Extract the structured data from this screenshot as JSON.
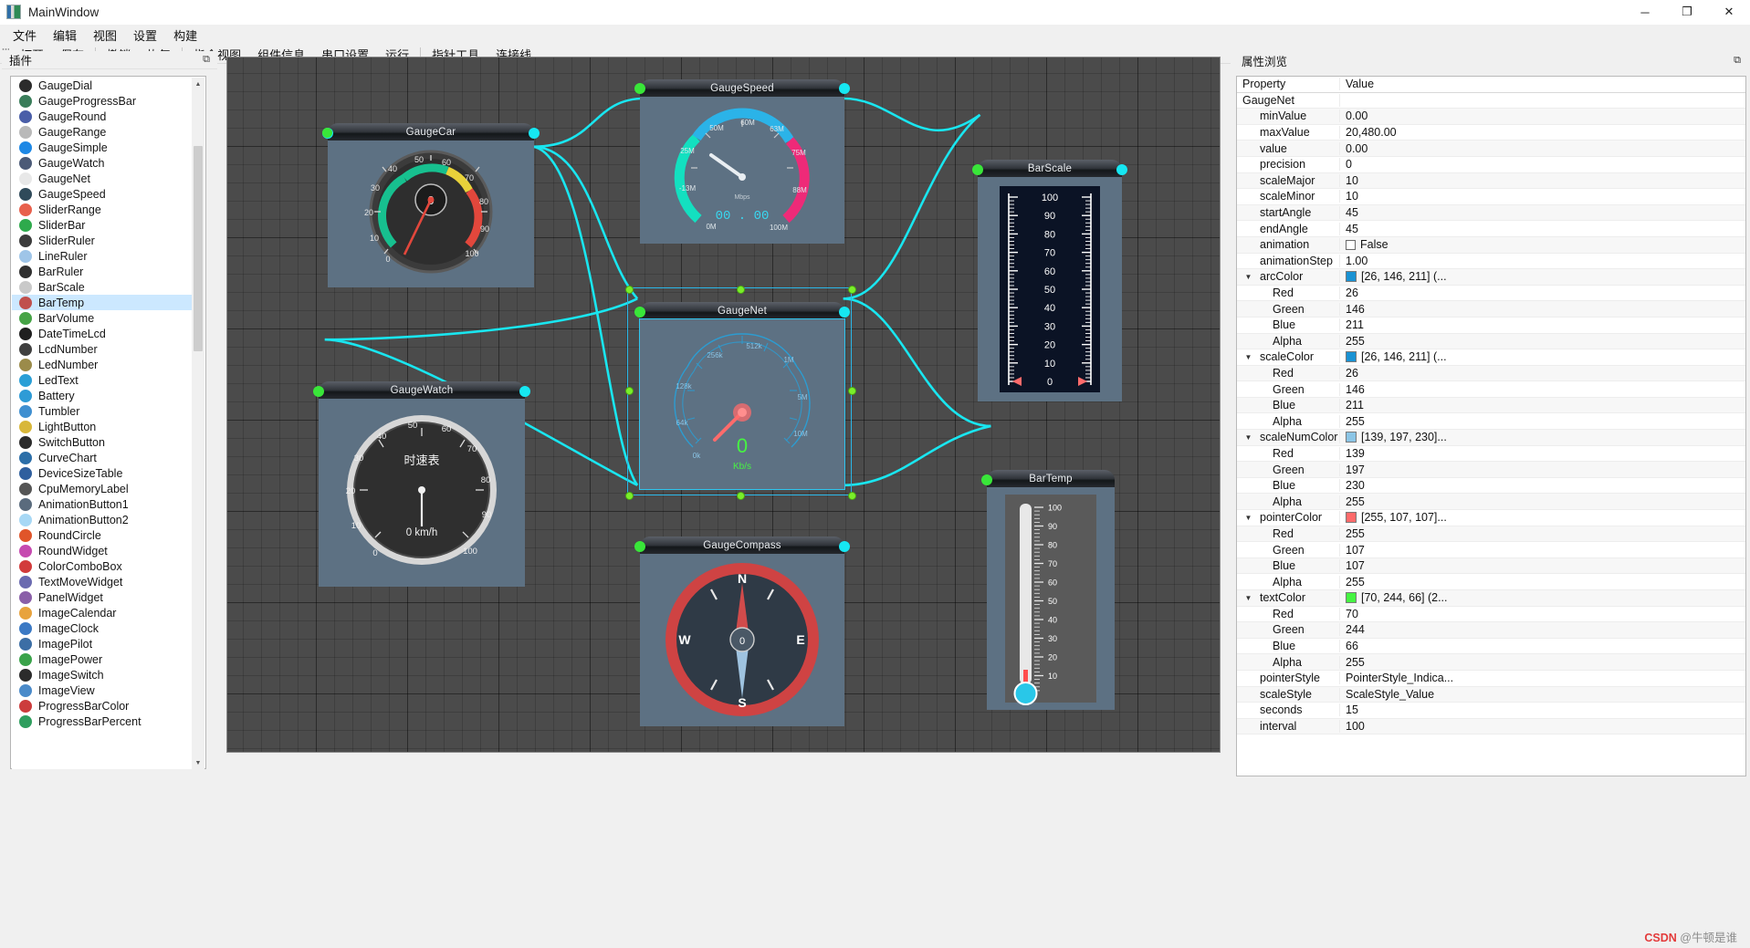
{
  "window": {
    "title": "MainWindow",
    "icon": "app-icon",
    "buttons": {
      "minimize": "─",
      "maximize": "❐",
      "close": "✕"
    }
  },
  "menubar": {
    "items": [
      "文件",
      "编辑",
      "视图",
      "设置",
      "构建"
    ]
  },
  "toolbar": {
    "groups": [
      [
        "打开",
        "保存"
      ],
      [
        "撤销",
        "恢复"
      ],
      [
        "指令视图",
        "组件信息",
        "串口设置",
        "运行"
      ],
      [
        "指针工具",
        "连接线"
      ]
    ]
  },
  "left_dock": {
    "title": "插件",
    "float_icon": "undock-icon",
    "selected": "BarTemp",
    "items": [
      {
        "label": "GaugeDial",
        "color": "#2b2b2b"
      },
      {
        "label": "GaugeProgressBar",
        "color": "#3a7d5a"
      },
      {
        "label": "GaugeRound",
        "color": "#4a5ea8"
      },
      {
        "label": "GaugeRange",
        "color": "#b9b9b9"
      },
      {
        "label": "GaugeSimple",
        "color": "#1e88e5"
      },
      {
        "label": "GaugeWatch",
        "color": "#4b5a77"
      },
      {
        "label": "GaugeNet",
        "color": "#e8e8e8"
      },
      {
        "label": "GaugeSpeed",
        "color": "#2f4a5a"
      },
      {
        "label": "SliderRange",
        "color": "#e8604c"
      },
      {
        "label": "SliderBar",
        "color": "#2eaa4c"
      },
      {
        "label": "SliderRuler",
        "color": "#3b3b3b"
      },
      {
        "label": "LineRuler",
        "color": "#9fc5e8"
      },
      {
        "label": "BarRuler",
        "color": "#303030"
      },
      {
        "label": "BarScale",
        "color": "#c9c9c9"
      },
      {
        "label": "BarTemp",
        "color": "#c0504d"
      },
      {
        "label": "BarVolume",
        "color": "#46a346"
      },
      {
        "label": "DateTimeLcd",
        "color": "#1f1f1f"
      },
      {
        "label": "LcdNumber",
        "color": "#404040"
      },
      {
        "label": "LedNumber",
        "color": "#9b8b4a"
      },
      {
        "label": "LedText",
        "color": "#2a9fd6"
      },
      {
        "label": "Battery",
        "color": "#2e9bd6"
      },
      {
        "label": "Tumbler",
        "color": "#3f8fd0"
      },
      {
        "label": "LightButton",
        "color": "#d8b73a"
      },
      {
        "label": "SwitchButton",
        "color": "#2b2b2b"
      },
      {
        "label": "CurveChart",
        "color": "#2b6ea8"
      },
      {
        "label": "DeviceSizeTable",
        "color": "#2f5f9e"
      },
      {
        "label": "CpuMemoryLabel",
        "color": "#555555"
      },
      {
        "label": "AnimationButton1",
        "color": "#5a6b7d"
      },
      {
        "label": "AnimationButton2",
        "color": "#a7d8f5"
      },
      {
        "label": "RoundCircle",
        "color": "#e0552a"
      },
      {
        "label": "RoundWidget",
        "color": "#c64ab0"
      },
      {
        "label": "ColorComboBox",
        "color": "#d23b3b"
      },
      {
        "label": "TextMoveWidget",
        "color": "#6a6ab0"
      },
      {
        "label": "PanelWidget",
        "color": "#8a5fa8"
      },
      {
        "label": "ImageCalendar",
        "color": "#e8a33d"
      },
      {
        "label": "ImageClock",
        "color": "#3b79c4"
      },
      {
        "label": "ImagePilot",
        "color": "#3c6ea5"
      },
      {
        "label": "ImagePower",
        "color": "#3aa34a"
      },
      {
        "label": "ImageSwitch",
        "color": "#2b2b2b"
      },
      {
        "label": "ImageView",
        "color": "#4a8ac9"
      },
      {
        "label": "ProgressBarColor",
        "color": "#cc3c3c"
      },
      {
        "label": "ProgressBarPercent",
        "color": "#2f9e5e"
      }
    ]
  },
  "canvas": {
    "widgets": [
      {
        "name": "GaugeCar",
        "title": "GaugeCar"
      },
      {
        "name": "GaugeSpeed",
        "title": "GaugeSpeed"
      },
      {
        "name": "GaugeNet",
        "title": "GaugeNet",
        "selected": true
      },
      {
        "name": "GaugeWatch",
        "title": "GaugeWatch"
      },
      {
        "name": "GaugeCompass",
        "title": "GaugeCompass"
      },
      {
        "name": "BarScale",
        "title": "BarScale"
      },
      {
        "name": "BarTemp",
        "title": "BarTemp"
      }
    ],
    "gauge_car": {
      "ticks": [
        "0",
        "10",
        "20",
        "30",
        "40",
        "50",
        "60",
        "70",
        "80",
        "90",
        "100"
      ],
      "value": "0"
    },
    "gauge_speed": {
      "ticks": [
        "0M",
        "25M",
        "50M",
        "60M",
        "63M",
        "75M",
        "88M",
        "100M"
      ],
      "unit": "Mbps",
      "display": "00 . 00"
    },
    "gauge_net": {
      "ticks": [
        "0k",
        "64k",
        "128k",
        "256k",
        "512k",
        "1M",
        "5M",
        "10M"
      ],
      "value": "0",
      "unit": "Kb/s"
    },
    "gauge_watch": {
      "label": "时速表",
      "ticks": [
        "0",
        "10",
        "20",
        "30",
        "40",
        "50",
        "60",
        "70",
        "80",
        "90",
        "100"
      ],
      "value": "0 km/h"
    },
    "gauge_compass": {
      "labels": [
        "N",
        "E",
        "S",
        "W"
      ],
      "value": "0"
    },
    "bar_scale": {
      "ticks": [
        "100",
        "90",
        "80",
        "70",
        "60",
        "50",
        "40",
        "30",
        "20",
        "10",
        "0"
      ]
    },
    "bar_temp": {
      "ticks": [
        "100",
        "90",
        "80",
        "70",
        "60",
        "50",
        "40",
        "30",
        "20",
        "10"
      ]
    }
  },
  "right_dock": {
    "title": "属性浏览",
    "float_icon": "undock-icon",
    "columns": [
      "Property",
      "Value"
    ],
    "object_name": "GaugeNet",
    "rows": [
      {
        "level": 1,
        "name": "minValue",
        "value": "0.00"
      },
      {
        "level": 1,
        "name": "maxValue",
        "value": "20,480.00"
      },
      {
        "level": 1,
        "name": "value",
        "value": "0.00"
      },
      {
        "level": 1,
        "name": "precision",
        "value": "0"
      },
      {
        "level": 1,
        "name": "scaleMajor",
        "value": "10"
      },
      {
        "level": 1,
        "name": "scaleMinor",
        "value": "10"
      },
      {
        "level": 1,
        "name": "startAngle",
        "value": "45"
      },
      {
        "level": 1,
        "name": "endAngle",
        "value": "45"
      },
      {
        "level": 1,
        "name": "animation",
        "value": "False",
        "checkbox": true
      },
      {
        "level": 1,
        "name": "animationStep",
        "value": "1.00"
      },
      {
        "level": 1,
        "name": "arcColor",
        "value": "[26, 146, 211] (...",
        "swatch": "#1a92d3",
        "expander": true
      },
      {
        "level": 2,
        "name": "Red",
        "value": "26"
      },
      {
        "level": 2,
        "name": "Green",
        "value": "146"
      },
      {
        "level": 2,
        "name": "Blue",
        "value": "211"
      },
      {
        "level": 2,
        "name": "Alpha",
        "value": "255"
      },
      {
        "level": 1,
        "name": "scaleColor",
        "value": "[26, 146, 211] (...",
        "swatch": "#1a92d3",
        "expander": true
      },
      {
        "level": 2,
        "name": "Red",
        "value": "26"
      },
      {
        "level": 2,
        "name": "Green",
        "value": "146"
      },
      {
        "level": 2,
        "name": "Blue",
        "value": "211"
      },
      {
        "level": 2,
        "name": "Alpha",
        "value": "255"
      },
      {
        "level": 1,
        "name": "scaleNumColor",
        "value": "[139, 197, 230]...",
        "swatch": "#8bc5e6",
        "expander": true
      },
      {
        "level": 2,
        "name": "Red",
        "value": "139"
      },
      {
        "level": 2,
        "name": "Green",
        "value": "197"
      },
      {
        "level": 2,
        "name": "Blue",
        "value": "230"
      },
      {
        "level": 2,
        "name": "Alpha",
        "value": "255"
      },
      {
        "level": 1,
        "name": "pointerColor",
        "value": "[255, 107, 107]...",
        "swatch": "#ff6b6b",
        "expander": true
      },
      {
        "level": 2,
        "name": "Red",
        "value": "255"
      },
      {
        "level": 2,
        "name": "Green",
        "value": "107"
      },
      {
        "level": 2,
        "name": "Blue",
        "value": "107"
      },
      {
        "level": 2,
        "name": "Alpha",
        "value": "255"
      },
      {
        "level": 1,
        "name": "textColor",
        "value": "[70, 244, 66] (2...",
        "swatch": "#46f442",
        "expander": true
      },
      {
        "level": 2,
        "name": "Red",
        "value": "70"
      },
      {
        "level": 2,
        "name": "Green",
        "value": "244"
      },
      {
        "level": 2,
        "name": "Blue",
        "value": "66"
      },
      {
        "level": 2,
        "name": "Alpha",
        "value": "255"
      },
      {
        "level": 1,
        "name": "pointerStyle",
        "value": "PointerStyle_Indica..."
      },
      {
        "level": 1,
        "name": "scaleStyle",
        "value": "ScaleStyle_Value"
      },
      {
        "level": 1,
        "name": "seconds",
        "value": "15"
      },
      {
        "level": 1,
        "name": "interval",
        "value": "100"
      }
    ]
  },
  "statusbar": {
    "watermark_prefix": "CSDN",
    "watermark_text": " @牛顿是谁"
  }
}
